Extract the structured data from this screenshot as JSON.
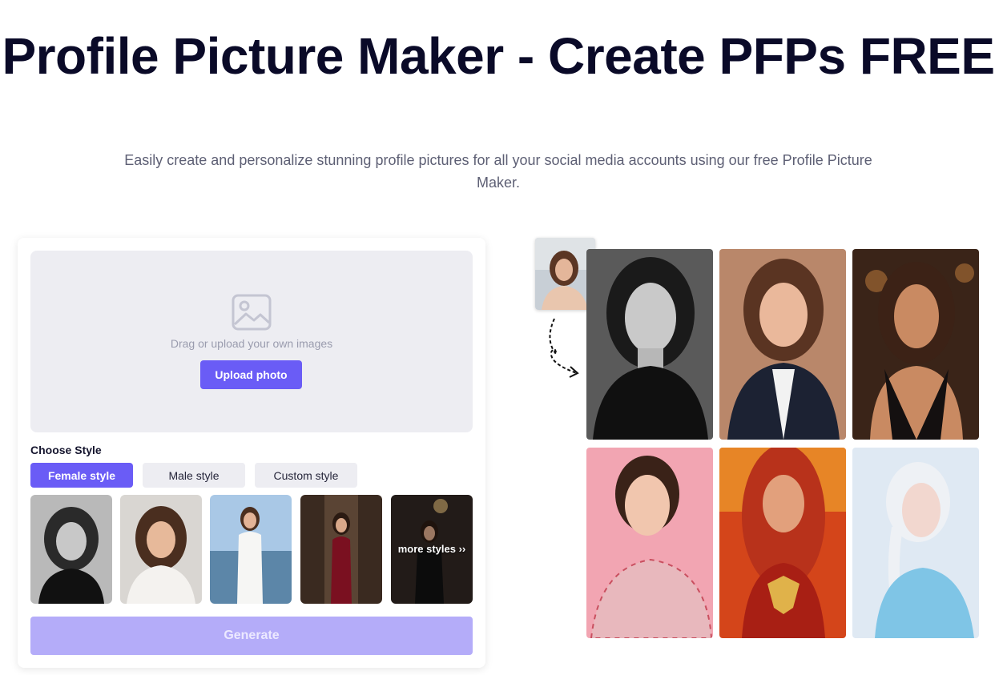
{
  "hero": {
    "title": "Profile Picture Maker - Create PFPs FREE",
    "subtitle": "Easily create and personalize stunning profile pictures for all your social media accounts using our free Profile Picture Maker."
  },
  "uploader": {
    "icon": "image-icon",
    "drag_text": "Drag or upload your own images",
    "upload_label": "Upload photo"
  },
  "styles": {
    "heading": "Choose Style",
    "tabs": [
      {
        "label": "Female style",
        "active": true
      },
      {
        "label": "Male style",
        "active": false
      },
      {
        "label": "Custom style",
        "active": false
      }
    ],
    "more_label": "more styles ››"
  },
  "generate_label": "Generate",
  "colors": {
    "accent": "#6a5cf6",
    "accent_disabled": "#b4acf9",
    "title": "#0a0a28",
    "dropzone_bg": "#ededf2"
  }
}
